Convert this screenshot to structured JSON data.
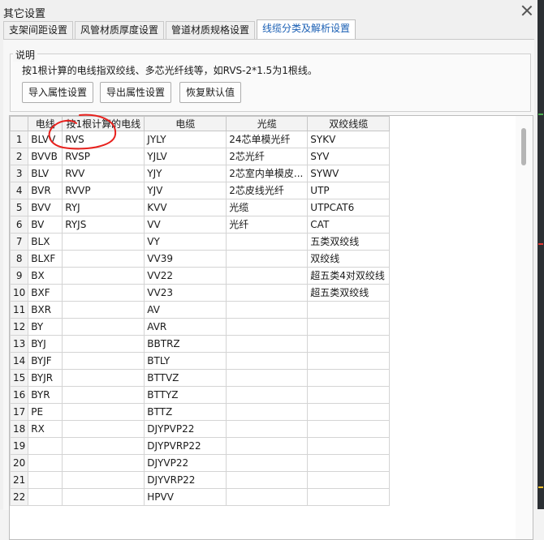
{
  "window": {
    "title": "其它设置"
  },
  "tabs": [
    {
      "label": "支架间距设置"
    },
    {
      "label": "风管材质厚度设置"
    },
    {
      "label": "管道材质规格设置"
    },
    {
      "label": "线缆分类及解析设置"
    }
  ],
  "active_tab": 3,
  "group": {
    "legend": "说明",
    "description": "按1根计算的电线指双绞线、多芯光纤线等，如RVS-2*1.5为1根线。"
  },
  "buttons": {
    "import": "导入属性设置",
    "export": "导出属性设置",
    "reset": "恢复默认值"
  },
  "table": {
    "columns": [
      "电线",
      "按1根计算的电线",
      "电缆",
      "光缆",
      "双绞线缆"
    ],
    "rows": [
      [
        "1",
        "BLVV",
        "RVS",
        "JYLY",
        "24芯单模光纤",
        "SYKV"
      ],
      [
        "2",
        "BVVB",
        "RVSP",
        "YJLV",
        "2芯光纤",
        "SYV"
      ],
      [
        "3",
        "BLV",
        "RVV",
        "YJY",
        "2芯室内单模皮...",
        "SYWV"
      ],
      [
        "4",
        "BVR",
        "RVVP",
        "YJV",
        "2芯皮线光纤",
        "UTP"
      ],
      [
        "5",
        "BVV",
        "RYJ",
        "KVV",
        "光缆",
        "UTPCAT6"
      ],
      [
        "6",
        "BV",
        "RYJS",
        "VV",
        "光纤",
        "CAT"
      ],
      [
        "7",
        "BLX",
        "",
        "VY",
        "",
        "五类双绞线"
      ],
      [
        "8",
        "BLXF",
        "",
        "VV39",
        "",
        "双绞线"
      ],
      [
        "9",
        "BX",
        "",
        "VV22",
        "",
        "超五类4对双绞线"
      ],
      [
        "10",
        "BXF",
        "",
        "VV23",
        "",
        "超五类双绞线"
      ],
      [
        "11",
        "BXR",
        "",
        "AV",
        "",
        ""
      ],
      [
        "12",
        "BY",
        "",
        "AVR",
        "",
        ""
      ],
      [
        "13",
        "BYJ",
        "",
        "BBTRZ",
        "",
        ""
      ],
      [
        "14",
        "BYJF",
        "",
        "BTLY",
        "",
        ""
      ],
      [
        "15",
        "BYJR",
        "",
        "BTTVZ",
        "",
        ""
      ],
      [
        "16",
        "BYR",
        "",
        "BTTYZ",
        "",
        ""
      ],
      [
        "17",
        "PE",
        "",
        "BTTZ",
        "",
        ""
      ],
      [
        "18",
        "RX",
        "",
        "DJYPVP22",
        "",
        ""
      ],
      [
        "19",
        "",
        "",
        "DJYPVRP22",
        "",
        ""
      ],
      [
        "20",
        "",
        "",
        "DJYVP22",
        "",
        ""
      ],
      [
        "21",
        "",
        "",
        "DJYVRP22",
        "",
        ""
      ],
      [
        "22",
        "",
        "",
        "HPVV",
        "",
        ""
      ]
    ]
  },
  "colors": {
    "annotation": "#e8211d",
    "active_tab": "#1a5fb4"
  }
}
